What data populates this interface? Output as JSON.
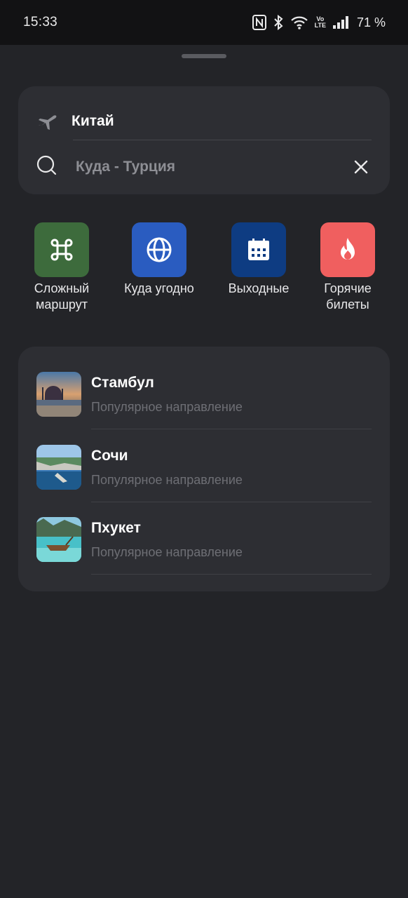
{
  "status_bar": {
    "time": "15:33",
    "volte_top": "Vo",
    "volte_bottom": "LTE",
    "battery": "71 %"
  },
  "search": {
    "from_value": "Китай",
    "to_placeholder": "Куда - Турция",
    "icons": {
      "from": "plane-icon",
      "to": "search-icon",
      "clear": "close-icon"
    }
  },
  "quick_actions": [
    {
      "label_line1": "Сложный",
      "label_line2": "маршрут",
      "icon": "command-icon",
      "color": "#3d6b3c"
    },
    {
      "label_line1": "Куда угодно",
      "label_line2": "",
      "icon": "globe-icon",
      "color": "#2a5cc0"
    },
    {
      "label_line1": "Выходные",
      "label_line2": "",
      "icon": "calendar-icon",
      "color": "#0e3c82"
    },
    {
      "label_line1": "Горячие",
      "label_line2": "билеты",
      "icon": "flame-icon",
      "color": "#f05f5f"
    }
  ],
  "destinations": [
    {
      "title": "Стамбул",
      "subtitle": "Популярное направление"
    },
    {
      "title": "Сочи",
      "subtitle": "Популярное направление"
    },
    {
      "title": "Пхукет",
      "subtitle": "Популярное направление"
    }
  ]
}
